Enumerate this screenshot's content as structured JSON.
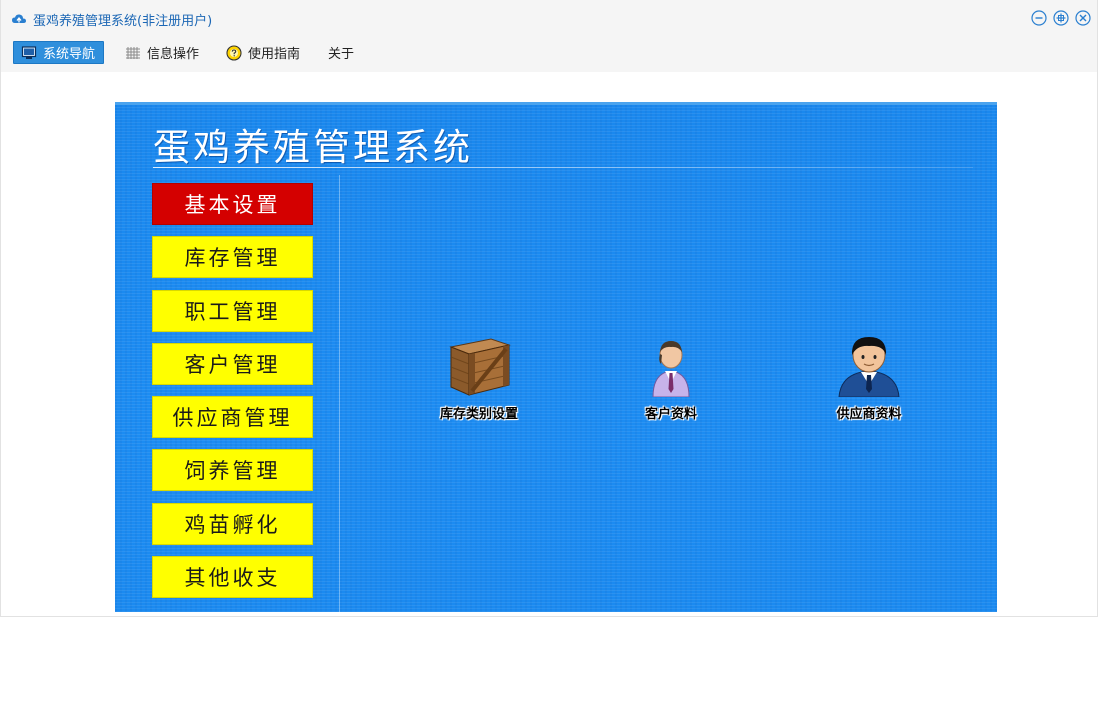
{
  "window": {
    "title": "蛋鸡养殖管理系统(非注册用户)",
    "app_icon": "cloud-app-icon",
    "controls": [
      "minimize-icon",
      "maximize-icon",
      "close-icon"
    ]
  },
  "menubar": {
    "items": [
      {
        "label": "系统导航",
        "icon": "monitor-icon",
        "active": true
      },
      {
        "label": "信息操作",
        "icon": "grid-icon",
        "active": false
      },
      {
        "label": "使用指南",
        "icon": "help-icon",
        "active": false
      },
      {
        "label": "关于",
        "icon": "",
        "active": false
      }
    ]
  },
  "panel": {
    "title": "蛋鸡养殖管理系统",
    "nav": [
      {
        "label": "基本设置",
        "active": true
      },
      {
        "label": "库存管理",
        "active": false
      },
      {
        "label": "职工管理",
        "active": false
      },
      {
        "label": "客户管理",
        "active": false
      },
      {
        "label": "供应商管理",
        "active": false
      },
      {
        "label": "饲养管理",
        "active": false
      },
      {
        "label": "鸡苗孵化",
        "active": false
      },
      {
        "label": "其他收支",
        "active": false
      }
    ],
    "tiles": [
      {
        "label": "库存类别设置",
        "icon": "wooden-crate-icon"
      },
      {
        "label": "客户资料",
        "icon": "customer-person-icon"
      },
      {
        "label": "供应商资料",
        "icon": "supplier-person-icon"
      }
    ]
  },
  "colors": {
    "accent": "#2f8fdc",
    "panel_background": "#1a8af0",
    "nav_button": "#ffff00",
    "nav_button_active": "#d40000",
    "title_text": "#1c67b5"
  }
}
